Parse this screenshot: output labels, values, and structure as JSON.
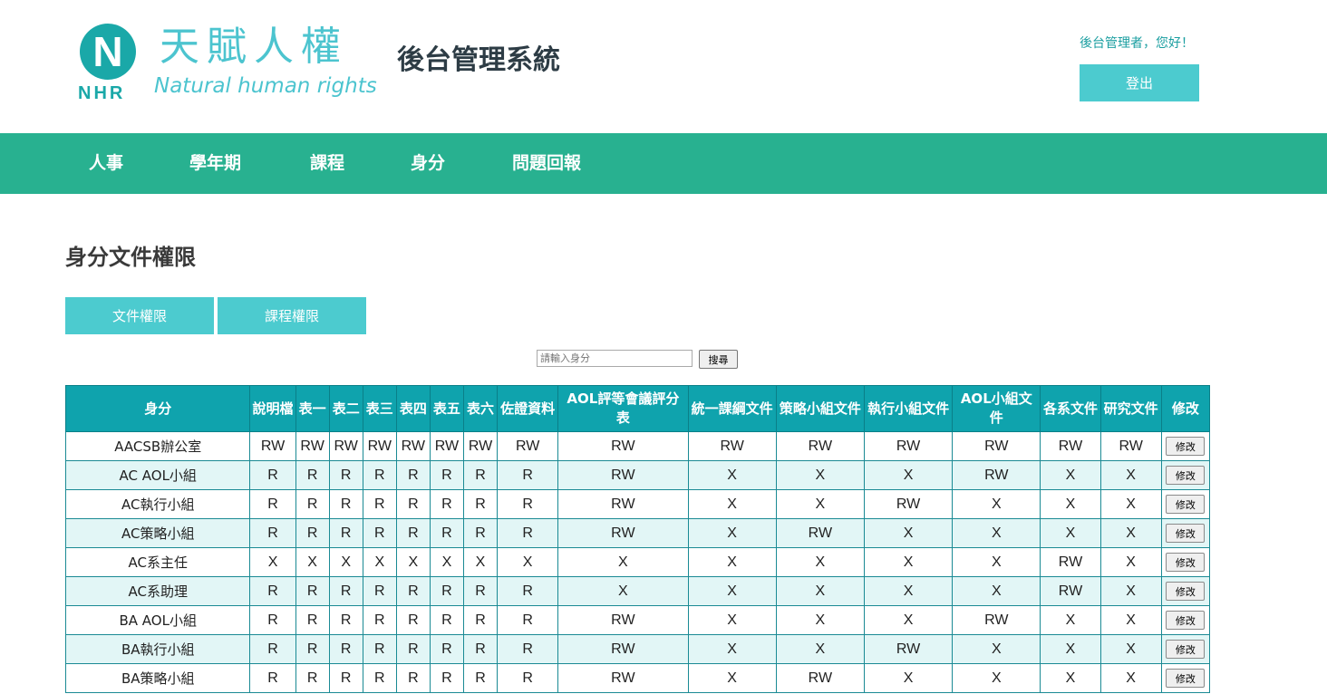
{
  "header": {
    "logo_letter": "N",
    "logo_abbr": "NHR",
    "logo_cn": "天賦人權",
    "logo_en": "Natural human rights",
    "system_title": "後台管理系統",
    "greeting": "後台管理者，您好！",
    "logout_label": "登出"
  },
  "nav": {
    "items": [
      "人事",
      "學年期",
      "課程",
      "身分",
      "問題回報"
    ]
  },
  "page": {
    "title": "身分文件權限",
    "tabs": [
      "文件權限",
      "課程權限"
    ],
    "search_placeholder": "請輸入身分",
    "search_label": "搜尋"
  },
  "colors": {
    "accent": "#4ccbcf",
    "nav_bg": "#28b190",
    "table_header": "#0fa3ad",
    "row_alt": "#e2f6f6"
  },
  "table": {
    "headers": [
      "身分",
      "說明檔",
      "表一",
      "表二",
      "表三",
      "表四",
      "表五",
      "表六",
      "佐證資料",
      "AOL評等會議評分表",
      "統一課綱文件",
      "策略小組文件",
      "執行小組文件",
      "AOL小組文件",
      "各系文件",
      "研究文件",
      "修改"
    ],
    "edit_label": "修改",
    "rows": [
      [
        "AACSB辦公室",
        "RW",
        "RW",
        "RW",
        "RW",
        "RW",
        "RW",
        "RW",
        "RW",
        "RW",
        "RW",
        "RW",
        "RW",
        "RW",
        "RW",
        "RW"
      ],
      [
        "AC AOL小組",
        "R",
        "R",
        "R",
        "R",
        "R",
        "R",
        "R",
        "R",
        "RW",
        "X",
        "X",
        "X",
        "RW",
        "X",
        "X"
      ],
      [
        "AC執行小組",
        "R",
        "R",
        "R",
        "R",
        "R",
        "R",
        "R",
        "R",
        "RW",
        "X",
        "X",
        "RW",
        "X",
        "X",
        "X"
      ],
      [
        "AC策略小組",
        "R",
        "R",
        "R",
        "R",
        "R",
        "R",
        "R",
        "R",
        "RW",
        "X",
        "RW",
        "X",
        "X",
        "X",
        "X"
      ],
      [
        "AC系主任",
        "X",
        "X",
        "X",
        "X",
        "X",
        "X",
        "X",
        "X",
        "X",
        "X",
        "X",
        "X",
        "X",
        "RW",
        "X"
      ],
      [
        "AC系助理",
        "R",
        "R",
        "R",
        "R",
        "R",
        "R",
        "R",
        "R",
        "X",
        "X",
        "X",
        "X",
        "X",
        "RW",
        "X"
      ],
      [
        "BA AOL小組",
        "R",
        "R",
        "R",
        "R",
        "R",
        "R",
        "R",
        "R",
        "RW",
        "X",
        "X",
        "X",
        "RW",
        "X",
        "X"
      ],
      [
        "BA執行小組",
        "R",
        "R",
        "R",
        "R",
        "R",
        "R",
        "R",
        "R",
        "RW",
        "X",
        "X",
        "RW",
        "X",
        "X",
        "X"
      ],
      [
        "BA策略小組",
        "R",
        "R",
        "R",
        "R",
        "R",
        "R",
        "R",
        "R",
        "RW",
        "X",
        "RW",
        "X",
        "X",
        "X",
        "X"
      ]
    ]
  }
}
